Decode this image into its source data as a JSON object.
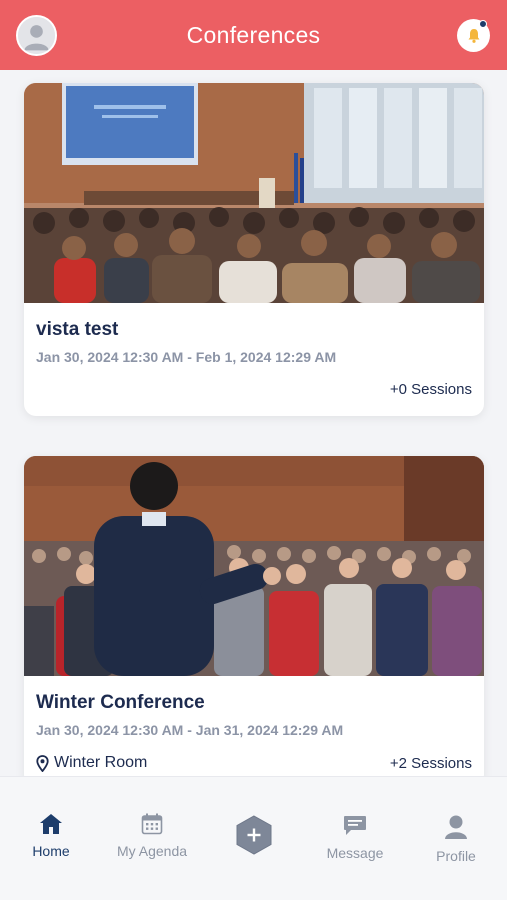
{
  "header": {
    "title": "Conferences",
    "accent_color": "#ec5f63"
  },
  "conferences": [
    {
      "title": "vista test",
      "date_range": "Jan 30, 2024 12:30 AM - Feb 1, 2024 12:29 AM",
      "location": "",
      "sessions": "+0 Sessions",
      "image": "conference-hall-audience-photo"
    },
    {
      "title": "Winter Conference",
      "date_range": "Jan 30, 2024 12:30 AM - Jan 31, 2024 12:29 AM",
      "location": "Winter Room",
      "sessions": "+2 Sessions",
      "image": "speaker-presenting-photo"
    }
  ],
  "tabbar": {
    "items": [
      {
        "label": "Home",
        "icon": "home-icon",
        "active": true
      },
      {
        "label": "My Agenda",
        "icon": "calendar-icon",
        "active": false
      },
      {
        "label": "",
        "icon": "add-hexagon-icon",
        "active": false
      },
      {
        "label": "Message",
        "icon": "message-icon",
        "active": false
      },
      {
        "label": "Profile",
        "icon": "profile-icon",
        "active": false
      }
    ],
    "active_color": "#1d3d6b",
    "inactive_color": "#8d95a3"
  }
}
